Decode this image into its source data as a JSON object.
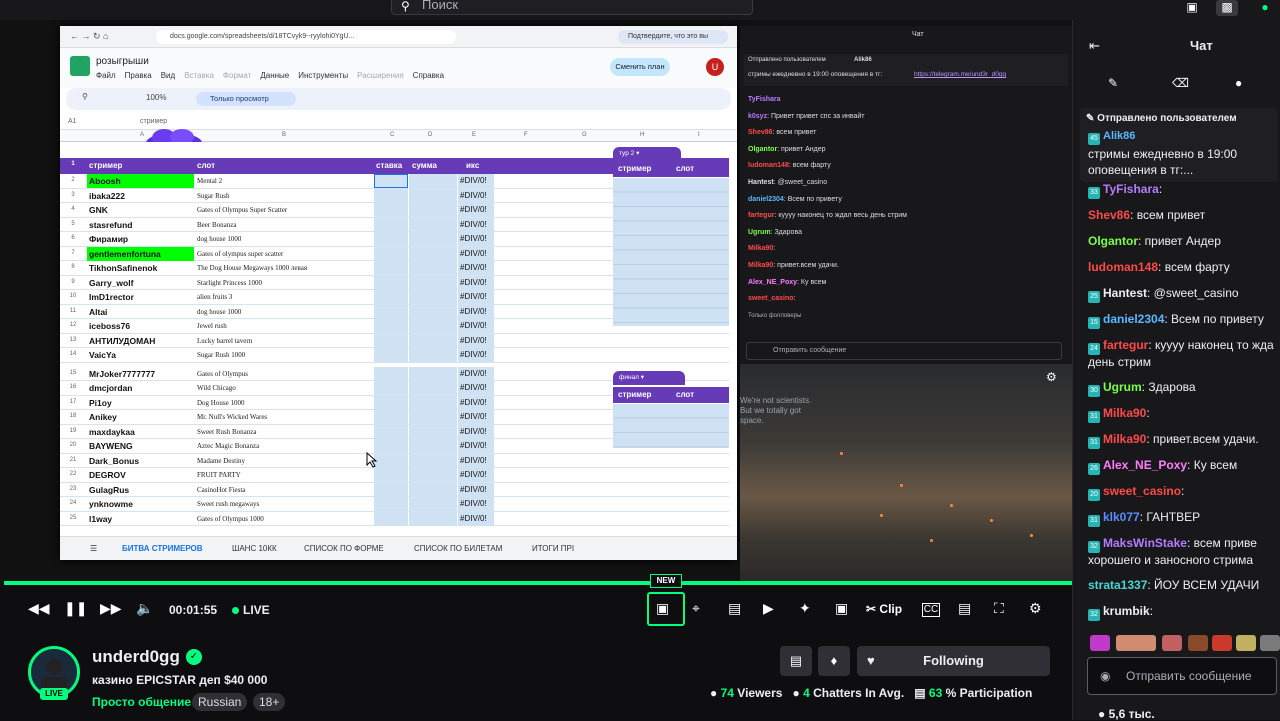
{
  "search": {
    "placeholder": "Поиск"
  },
  "sheet": {
    "url": "docs.google.com/spreadsheets/d/18TCvyk9--ryylohi0YgU...",
    "verify_label": "Подтвердите, что это вы",
    "doc_name": "розыгрыши",
    "menu": [
      "Файл",
      "Правка",
      "Вид",
      "Вставка",
      "Формат",
      "Данные",
      "Инструменты",
      "Расширения",
      "Справка"
    ],
    "plan_button": "Сменить план",
    "avatar_letter": "U",
    "zoom": "100%",
    "view_only": "Только просмотр",
    "cell_ref": "A1",
    "cell_value": "стример",
    "columns": [
      "A",
      "B",
      "C",
      "D",
      "E",
      "F",
      "G",
      "H",
      "I"
    ],
    "header": {
      "streamer": "стример",
      "slot": "слот",
      "bet": "ставка",
      "sum": "сумма",
      "x": "икс"
    },
    "rows": [
      {
        "n": "2",
        "streamer": "Aboosh",
        "slot": "Mental 2",
        "x": "#DIV/0!",
        "green": true
      },
      {
        "n": "3",
        "streamer": "ibaka222",
        "slot": "Sugar Rush",
        "x": "#DIV/0!"
      },
      {
        "n": "4",
        "streamer": "GNK",
        "slot": "Gates of Olympus Super Scatter",
        "x": "#DIV/0!"
      },
      {
        "n": "5",
        "streamer": "stasrefund",
        "slot": "Beer Bonanza",
        "x": "#DIV/0!"
      },
      {
        "n": "6",
        "streamer": "Фирамир",
        "slot": "dog house 1000",
        "x": "#DIV/0!"
      },
      {
        "n": "7",
        "streamer": "gentlemenfortuna",
        "slot": "Gates of olympus super scatter",
        "x": "#DIV/0!",
        "green": true
      },
      {
        "n": "8",
        "streamer": "TikhonSafinenok",
        "slot": "The Dog House Megaways 1000 левая",
        "x": "#DIV/0!"
      },
      {
        "n": "9",
        "streamer": "Garry_wolf",
        "slot": "Starlight Princess 1000",
        "x": "#DIV/0!"
      },
      {
        "n": "10",
        "streamer": "ImD1rector",
        "slot": "alien fruits 3",
        "x": "#DIV/0!"
      },
      {
        "n": "11",
        "streamer": "Altai",
        "slot": "dog house 1000",
        "x": "#DIV/0!"
      },
      {
        "n": "12",
        "streamer": "iceboss76",
        "slot": "Jewel rush",
        "x": "#DIV/0!"
      },
      {
        "n": "13",
        "streamer": "АНТИЛУДОМАН",
        "slot": "Lucky barrel tavern",
        "x": "#DIV/0!"
      },
      {
        "n": "14",
        "streamer": "VaicYa",
        "slot": "Sugar Rush 1000",
        "x": "#DIV/0!"
      },
      {
        "n": "15",
        "streamer": "MrJoker7777777",
        "slot": "Gates of Olympus",
        "x": "#DIV/0!"
      },
      {
        "n": "16",
        "streamer": "dmcjordan",
        "slot": "Wild Chicago",
        "x": "#DIV/0!"
      },
      {
        "n": "17",
        "streamer": "Pi1oy",
        "slot": "Dog House 1000",
        "x": "#DIV/0!"
      },
      {
        "n": "18",
        "streamer": "Anikey",
        "slot": "Mr. Null's Wicked Wares",
        "x": "#DIV/0!"
      },
      {
        "n": "19",
        "streamer": "maxdaykaa",
        "slot": "Sweet Rush Bonanza",
        "x": "#DIV/0!"
      },
      {
        "n": "20",
        "streamer": "BAYWENG",
        "slot": "Aztec Magic Bonanza",
        "x": "#DIV/0!"
      },
      {
        "n": "21",
        "streamer": "Dark_Bonus",
        "slot": "Madame Destiny",
        "x": "#DIV/0!"
      },
      {
        "n": "22",
        "streamer": "DEGROV",
        "slot": "FRUIT PARTY",
        "x": "#DIV/0!"
      },
      {
        "n": "23",
        "streamer": "GulagRus",
        "slot": "CasinoHot Fiesta",
        "x": "#DIV/0!"
      },
      {
        "n": "24",
        "streamer": "ynknowme",
        "slot": "Sweet rush megaways",
        "x": "#DIV/0!"
      },
      {
        "n": "25",
        "streamer": "l1way",
        "slot": "Gates of Olympus 1000",
        "x": "#DIV/0!"
      }
    ],
    "side_chip_1": "тур 2",
    "side_chip_2": "финал",
    "side_streamer": "стример",
    "side_slot": "слот",
    "tabs": [
      "БИТВА СТРИМЕРОВ",
      "ШАНС 10КК",
      "СПИСОК ПО ФОРМЕ",
      "СПИСОК ПО БИЛЕТАМ",
      "ИТОГИ ПРІ"
    ]
  },
  "inner_chat": {
    "title": "Чат",
    "pinned_label": "Отправлено пользователем",
    "pinned_user": "Alik86",
    "pinned_text": "стримы ежедневно в 19:00 оповещения в тг:",
    "pinned_link": "https://telegram.me/und3r_d0gg",
    "messages": [
      {
        "user": "TyFishara",
        "text": "",
        "color": "#b57cff"
      },
      {
        "user": "k0syz",
        "text": ": Привет привет спс за инвайт",
        "color": "#b57cff"
      },
      {
        "user": "Shev86",
        "text": ": всем привет",
        "color": "#ff4a4a"
      },
      {
        "user": "Olgantor",
        "text": ": привет Андер",
        "color": "#7cff4a"
      },
      {
        "user": "ludoman148",
        "text": ": всем фарту",
        "color": "#ff4a4a"
      },
      {
        "user": "Hantest",
        "text": ": @sweet_casino",
        "color": "#dedee3"
      },
      {
        "user": "daniel2304",
        "text": ": Всем по привету",
        "color": "#5cb8ff"
      },
      {
        "user": "fartegur",
        "text": ": куууу наконец то ждал весь день стрим",
        "color": "#ff4a4a"
      },
      {
        "user": "Ugrum",
        "text": ": Здарова",
        "color": "#7cff4a"
      },
      {
        "user": "Milka90",
        "text": ":",
        "color": "#ff4a4a"
      },
      {
        "user": "Milka90",
        "text": ": привет.всем удачи.",
        "color": "#ff4a4a"
      },
      {
        "user": "Alex_NE_Poxy",
        "text": ": Ку всем",
        "color": "#ff7cff"
      },
      {
        "user": "sweet_casino",
        "text": ":",
        "color": "#ff4a4a"
      }
    ],
    "followers_only": "Только фолловеры",
    "input_placeholder": "Отправить сообщение",
    "city_text": "We're not scientists. But we totally got space."
  },
  "player": {
    "time": "00:01:55",
    "live": "LIVE",
    "new_badge": "NEW",
    "clip_label": "Clip",
    "progress": 1.0
  },
  "channel": {
    "name": "underd0gg",
    "live_pill": "LIVE",
    "title": "казино EPICSTAR деп $40 000",
    "category": "Просто общение",
    "tags": [
      "Russian",
      "18+"
    ],
    "follow_label": "Following",
    "viewers": "74",
    "viewers_label": "Viewers",
    "chatters": "4",
    "chatters_label": "Chatters In Avg.",
    "participation": "63",
    "participation_label": "% Participation"
  },
  "chat": {
    "title": "Чат",
    "pinned_label": "Отправлено пользователем",
    "pinned_badge": "45",
    "pinned_user": "Alik86",
    "pinned_text": "стримы ежедневно в 19:00 оповещения в тг:...",
    "messages": [
      {
        "badge": "33",
        "user": "TyFishara",
        "text": ": ",
        "color": "#b57cff"
      },
      {
        "badge": "",
        "user": "Shev86",
        "text": ": всем привет",
        "color": "#ff4a4a"
      },
      {
        "badge": "",
        "user": "Olgantor",
        "text": ": привет Андер",
        "color": "#7cff4a"
      },
      {
        "badge": "",
        "user": "ludoman148",
        "text": ": всем фарту",
        "color": "#ff4a4a"
      },
      {
        "badge": "25",
        "user": "Hantest",
        "text": ": @sweet_casino",
        "color": "#efeff1"
      },
      {
        "badge": "15",
        "user": "daniel2304",
        "text": ": Всем по привету",
        "color": "#5cb8ff"
      },
      {
        "badge": "24",
        "user": "fartegur",
        "text": ": куууу наконец то жда",
        "color": "#ff4a4a"
      },
      {
        "badge": "",
        "user": "",
        "text": "день стрим",
        "color": "#efeff1"
      },
      {
        "badge": "30",
        "user": "Ugrum",
        "text": ": Здарова",
        "color": "#7cff4a"
      },
      {
        "badge": "31",
        "user": "Milka90",
        "text": ": ",
        "color": "#ff4a4a"
      },
      {
        "badge": "31",
        "user": "Milka90",
        "text": ": привет.всем удачи.",
        "color": "#ff4a4a"
      },
      {
        "badge": "26",
        "user": "Alex_NE_Poxy",
        "text": ": Ку всем",
        "color": "#ff7cff"
      },
      {
        "badge": "20",
        "user": "sweet_casino",
        "text": ":",
        "color": "#ff4a4a"
      },
      {
        "badge": "31",
        "user": "klk077",
        "text": ": ГАНТВЕР",
        "color": "#5c8cff"
      },
      {
        "badge": "32",
        "user": "MaksWinStake",
        "text": ": всем приве",
        "color": "#b57cff"
      },
      {
        "badge": "",
        "user": "",
        "text": "хорошего и заносного стрима",
        "color": "#efeff1"
      },
      {
        "badge": "",
        "user": "strata1337",
        "text": ": ЙОУ ВСЕМ УДАЧИ",
        "color": "#4ad4d4"
      },
      {
        "badge": "32",
        "user": "krumbik",
        "text": ":",
        "color": "#efeff1"
      }
    ],
    "input_placeholder": "Отправить сообщение",
    "count": "5,6 тыс."
  },
  "colors": {
    "accent": "#00ff7f",
    "sheet_header": "#673ab7",
    "sheet_blue": "#cfe2f3",
    "highlight": "#00ff00"
  }
}
